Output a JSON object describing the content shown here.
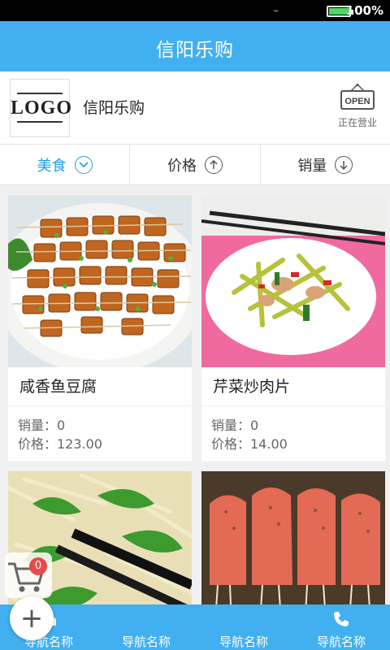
{
  "status_bar": {
    "battery_text": "100%",
    "battery_level": 1.0
  },
  "app_bar": {
    "title": "信阳乐购"
  },
  "store": {
    "logo_text": "LOGO",
    "name": "信阳乐购",
    "open_sign": "OPEN",
    "status": "正在营业"
  },
  "filters": [
    {
      "label": "美食",
      "icon": "chevron-down-icon"
    },
    {
      "label": "价格",
      "icon": "arrow-up-icon"
    },
    {
      "label": "销量",
      "icon": "arrow-down-icon"
    }
  ],
  "products": [
    {
      "name": "咸香鱼豆腐",
      "sales": "销量：0",
      "price": "价格：123.00"
    },
    {
      "name": "芹菜炒肉片",
      "sales": "销量：0",
      "price": "价格：14.00"
    },
    {
      "name": "",
      "sales": "",
      "price": ""
    },
    {
      "name": "",
      "sales": "",
      "price": ""
    }
  ],
  "cart": {
    "count": "0"
  },
  "nav": [
    {
      "label": "导航名称",
      "icon": "home-icon"
    },
    {
      "label": "导航名称",
      "icon": "none"
    },
    {
      "label": "导航名称",
      "icon": "none"
    },
    {
      "label": "导航名称",
      "icon": "phone-icon"
    }
  ],
  "colors": {
    "primary": "#42b0f0",
    "accent": "#1fa1ec",
    "badge": "#e84a4a"
  }
}
